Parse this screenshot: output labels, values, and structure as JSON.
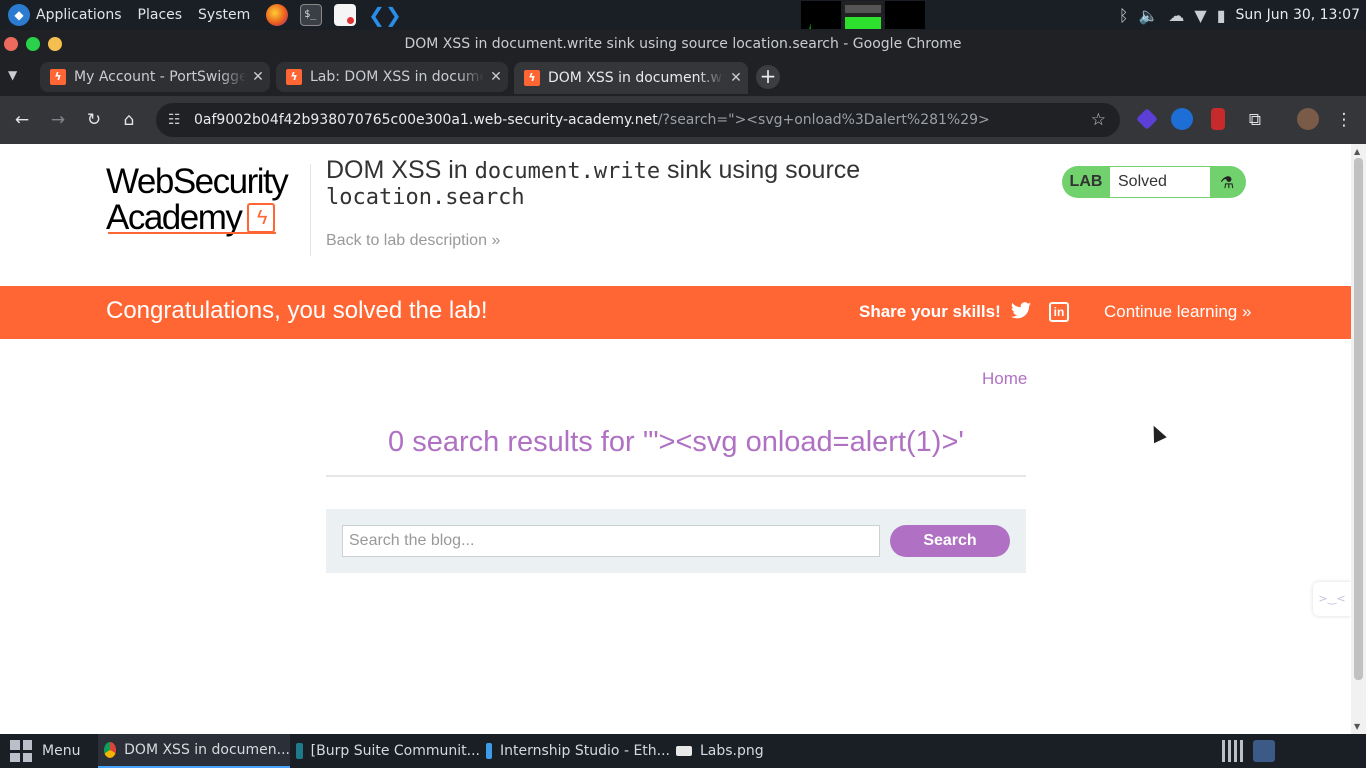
{
  "os_panel": {
    "menu_applications": "Applications",
    "menu_places": "Places",
    "menu_system": "System",
    "clock": "Sun Jun 30, 13:07",
    "launchers": [
      "firefox-icon",
      "terminal-icon",
      "text-editor-icon",
      "vscode-icon"
    ]
  },
  "window": {
    "title": "DOM XSS in document.write sink using source location.search - Google Chrome"
  },
  "tabs": [
    {
      "title": "My Account - PortSwigger"
    },
    {
      "title": "Lab: DOM XSS in document.write sink"
    },
    {
      "title": "DOM XSS in document.write sink"
    }
  ],
  "omnibox": {
    "host": "0af9002b04f42b938070765c00e300a1.web-security-academy.net",
    "rest": "/?search=\"><svg+onload%3Dalert%281%29>"
  },
  "header": {
    "logo_line1": "WebSecurity",
    "logo_line2": "Academy",
    "title_prefix": "DOM XSS in ",
    "title_code1": "document.write",
    "title_middle": " sink using source",
    "title_code2": "location.search",
    "back_link": "Back to lab description",
    "lab_label": "LAB",
    "lab_status": "Solved"
  },
  "banner": {
    "congrats": "Congratulations, you solved the lab!",
    "share": "Share your skills!",
    "continue": "Continue learning"
  },
  "main": {
    "home_link": "Home",
    "results_heading": "0 search results for '\"><svg onload=alert(1)>'",
    "search_placeholder": "Search the blog...",
    "search_button": "Search"
  },
  "taskbar": {
    "menu": "Menu",
    "tasks": [
      {
        "label": "DOM XSS in documen..."
      },
      {
        "label": "[Burp Suite Communit..."
      },
      {
        "label": "Internship Studio - Eth..."
      },
      {
        "label": "Labs.png"
      }
    ]
  },
  "colors": {
    "accent_orange": "#ff6633",
    "accent_purple": "#b071c4",
    "solved_green": "#70d16d"
  }
}
